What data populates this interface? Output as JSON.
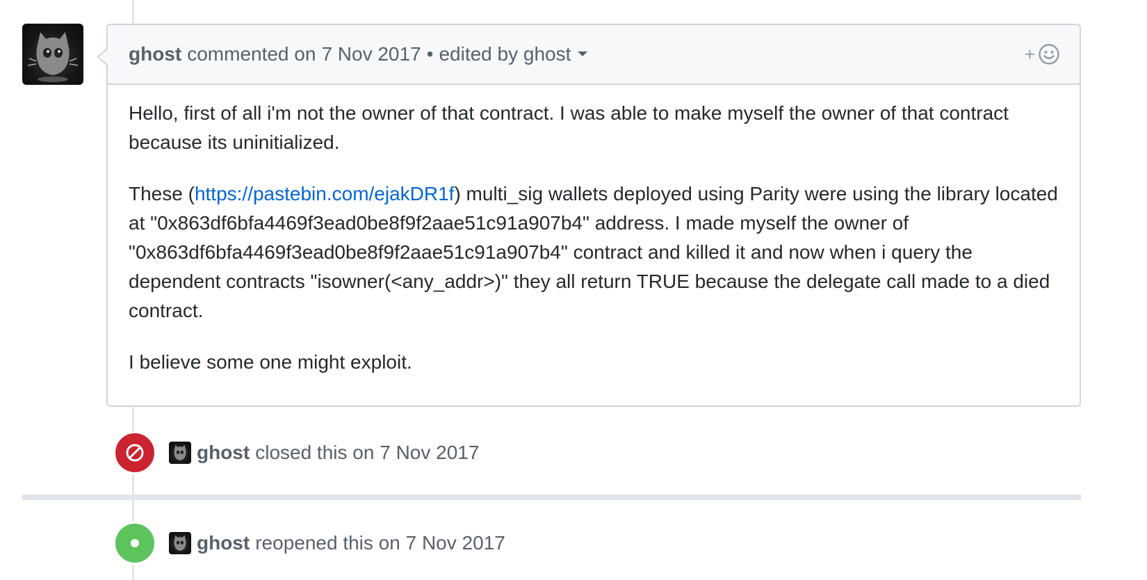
{
  "comment": {
    "author": "ghost",
    "action": "commented on",
    "date": "7 Nov 2017",
    "separator": "•",
    "edited": "edited by ghost",
    "reaction_plus": "+",
    "paragraphs": [
      {
        "text": "Hello, first of all i'm not the owner of that contract. I was able to make myself the owner of that contract because its uninitialized."
      },
      {
        "before_link": "These (",
        "link": "https://pastebin.com/ejakDR1f",
        "after_link": ") multi_sig wallets deployed using Parity were using the library located at \"0x863df6bfa4469f3ead0be8f9f2aae51c91a907b4\" address. I made myself the owner of \"0x863df6bfa4469f3ead0be8f9f2aae51c91a907b4\" contract and killed it and now when i query the dependent contracts \"isowner(<any_addr>)\" they all return TRUE because the delegate call made to a died contract."
      },
      {
        "text": "I believe some one might exploit."
      }
    ]
  },
  "events": [
    {
      "type": "closed",
      "author": "ghost",
      "text": "closed this on 7 Nov 2017",
      "color": "#cb2431"
    },
    {
      "type": "reopened",
      "author": "ghost",
      "text": "reopened this on 7 Nov 2017",
      "color": "#5cc35d"
    }
  ]
}
